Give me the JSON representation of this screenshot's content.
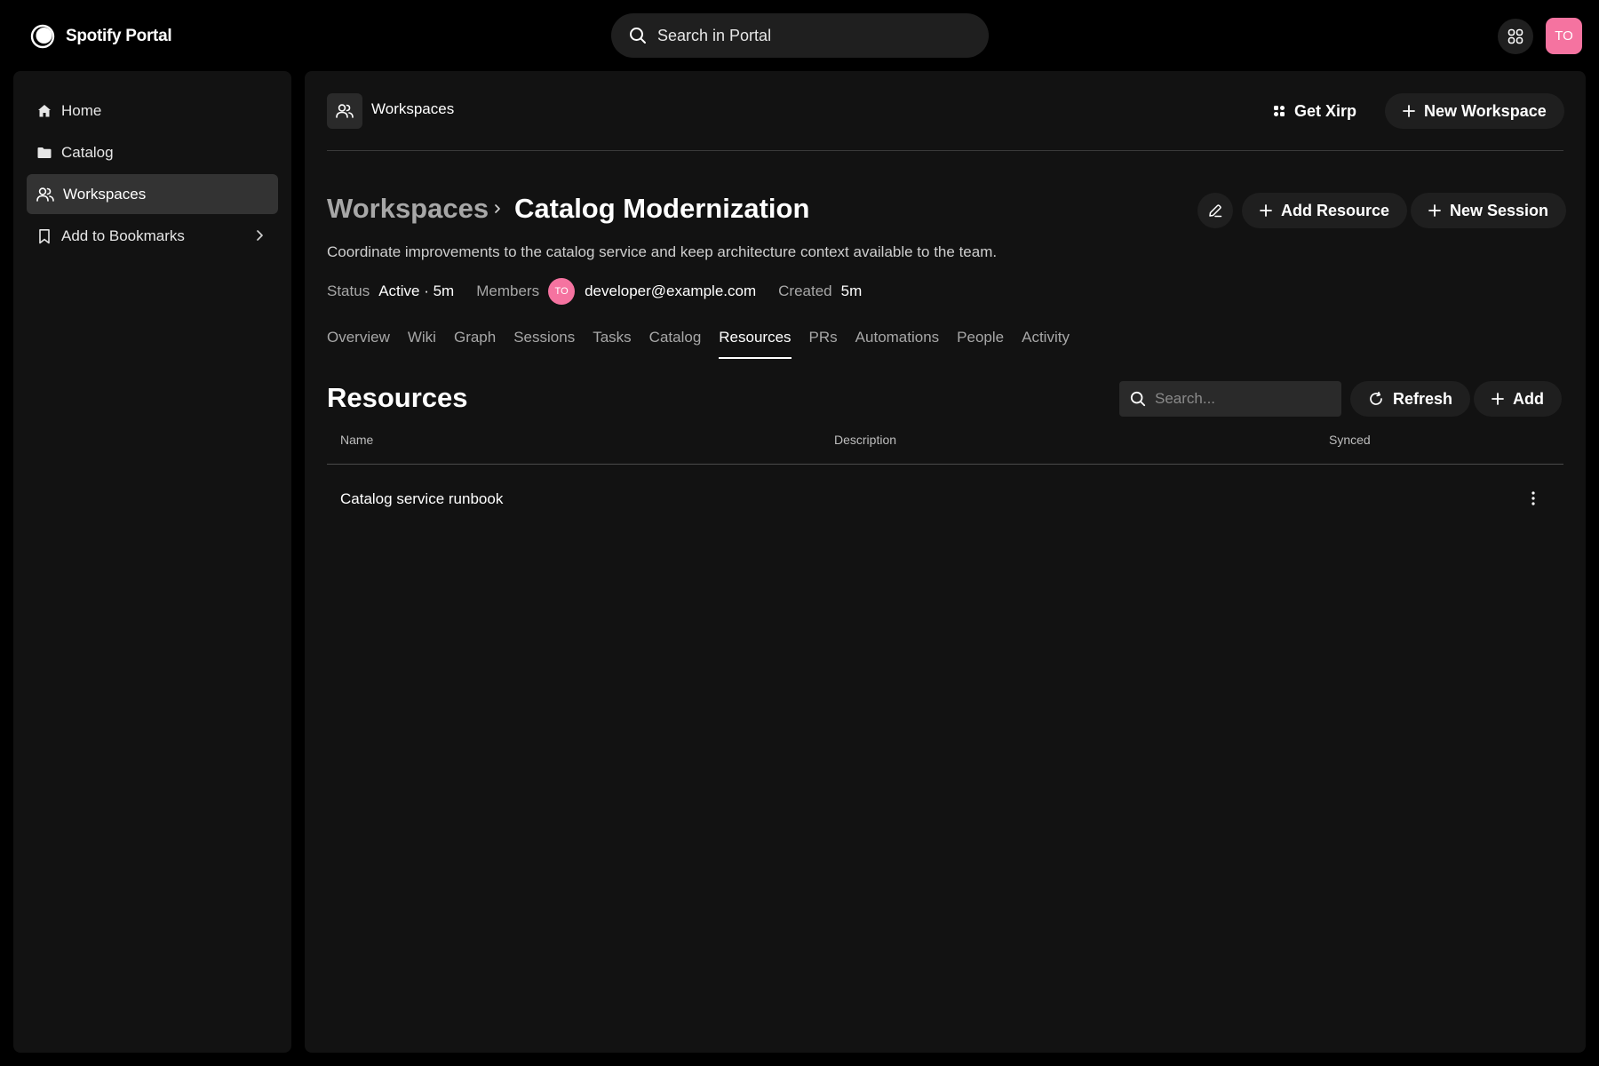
{
  "app": {
    "name": "Spotify Portal"
  },
  "global_search": {
    "placeholder": "Search in Portal"
  },
  "user": {
    "initials": "TO"
  },
  "sidebar": {
    "items": [
      {
        "label": "Home",
        "icon": "home-icon"
      },
      {
        "label": "Catalog",
        "icon": "folder-icon"
      },
      {
        "label": "Workspaces",
        "icon": "users-icon",
        "active": true
      },
      {
        "label": "Add to Bookmarks",
        "icon": "bookmark-icon"
      }
    ]
  },
  "header": {
    "title": "Workspaces",
    "get_xirp_label": "Get Xirp",
    "new_workspace_label": "New Workspace"
  },
  "workspace": {
    "breadcrumb_root": "Workspaces",
    "name": "Catalog Modernization",
    "description": "Coordinate improvements to the catalog service and keep architecture context available to the team.",
    "add_resource_label": "Add Resource",
    "new_session_label": "New Session",
    "meta": {
      "status_label": "Status",
      "status_value": "Active · 5m",
      "members_label": "Members",
      "member_initials": "TO",
      "member_email": "developer@example.com",
      "created_label": "Created",
      "created_value": "5m"
    }
  },
  "tabs": [
    "Overview",
    "Wiki",
    "Graph",
    "Sessions",
    "Tasks",
    "Catalog",
    "Resources",
    "PRs",
    "Automations",
    "People",
    "Activity"
  ],
  "active_tab": "Resources",
  "resources": {
    "title": "Resources",
    "search_placeholder": "Search...",
    "refresh_label": "Refresh",
    "add_label": "Add",
    "columns": [
      "Name",
      "Description",
      "Synced"
    ],
    "rows": [
      {
        "name": "Catalog service runbook",
        "description": "",
        "synced": ""
      }
    ]
  },
  "colors": {
    "background": "#000000",
    "panel": "#121212",
    "accent_pink": "#f573a0",
    "active_nav": "#333333"
  }
}
